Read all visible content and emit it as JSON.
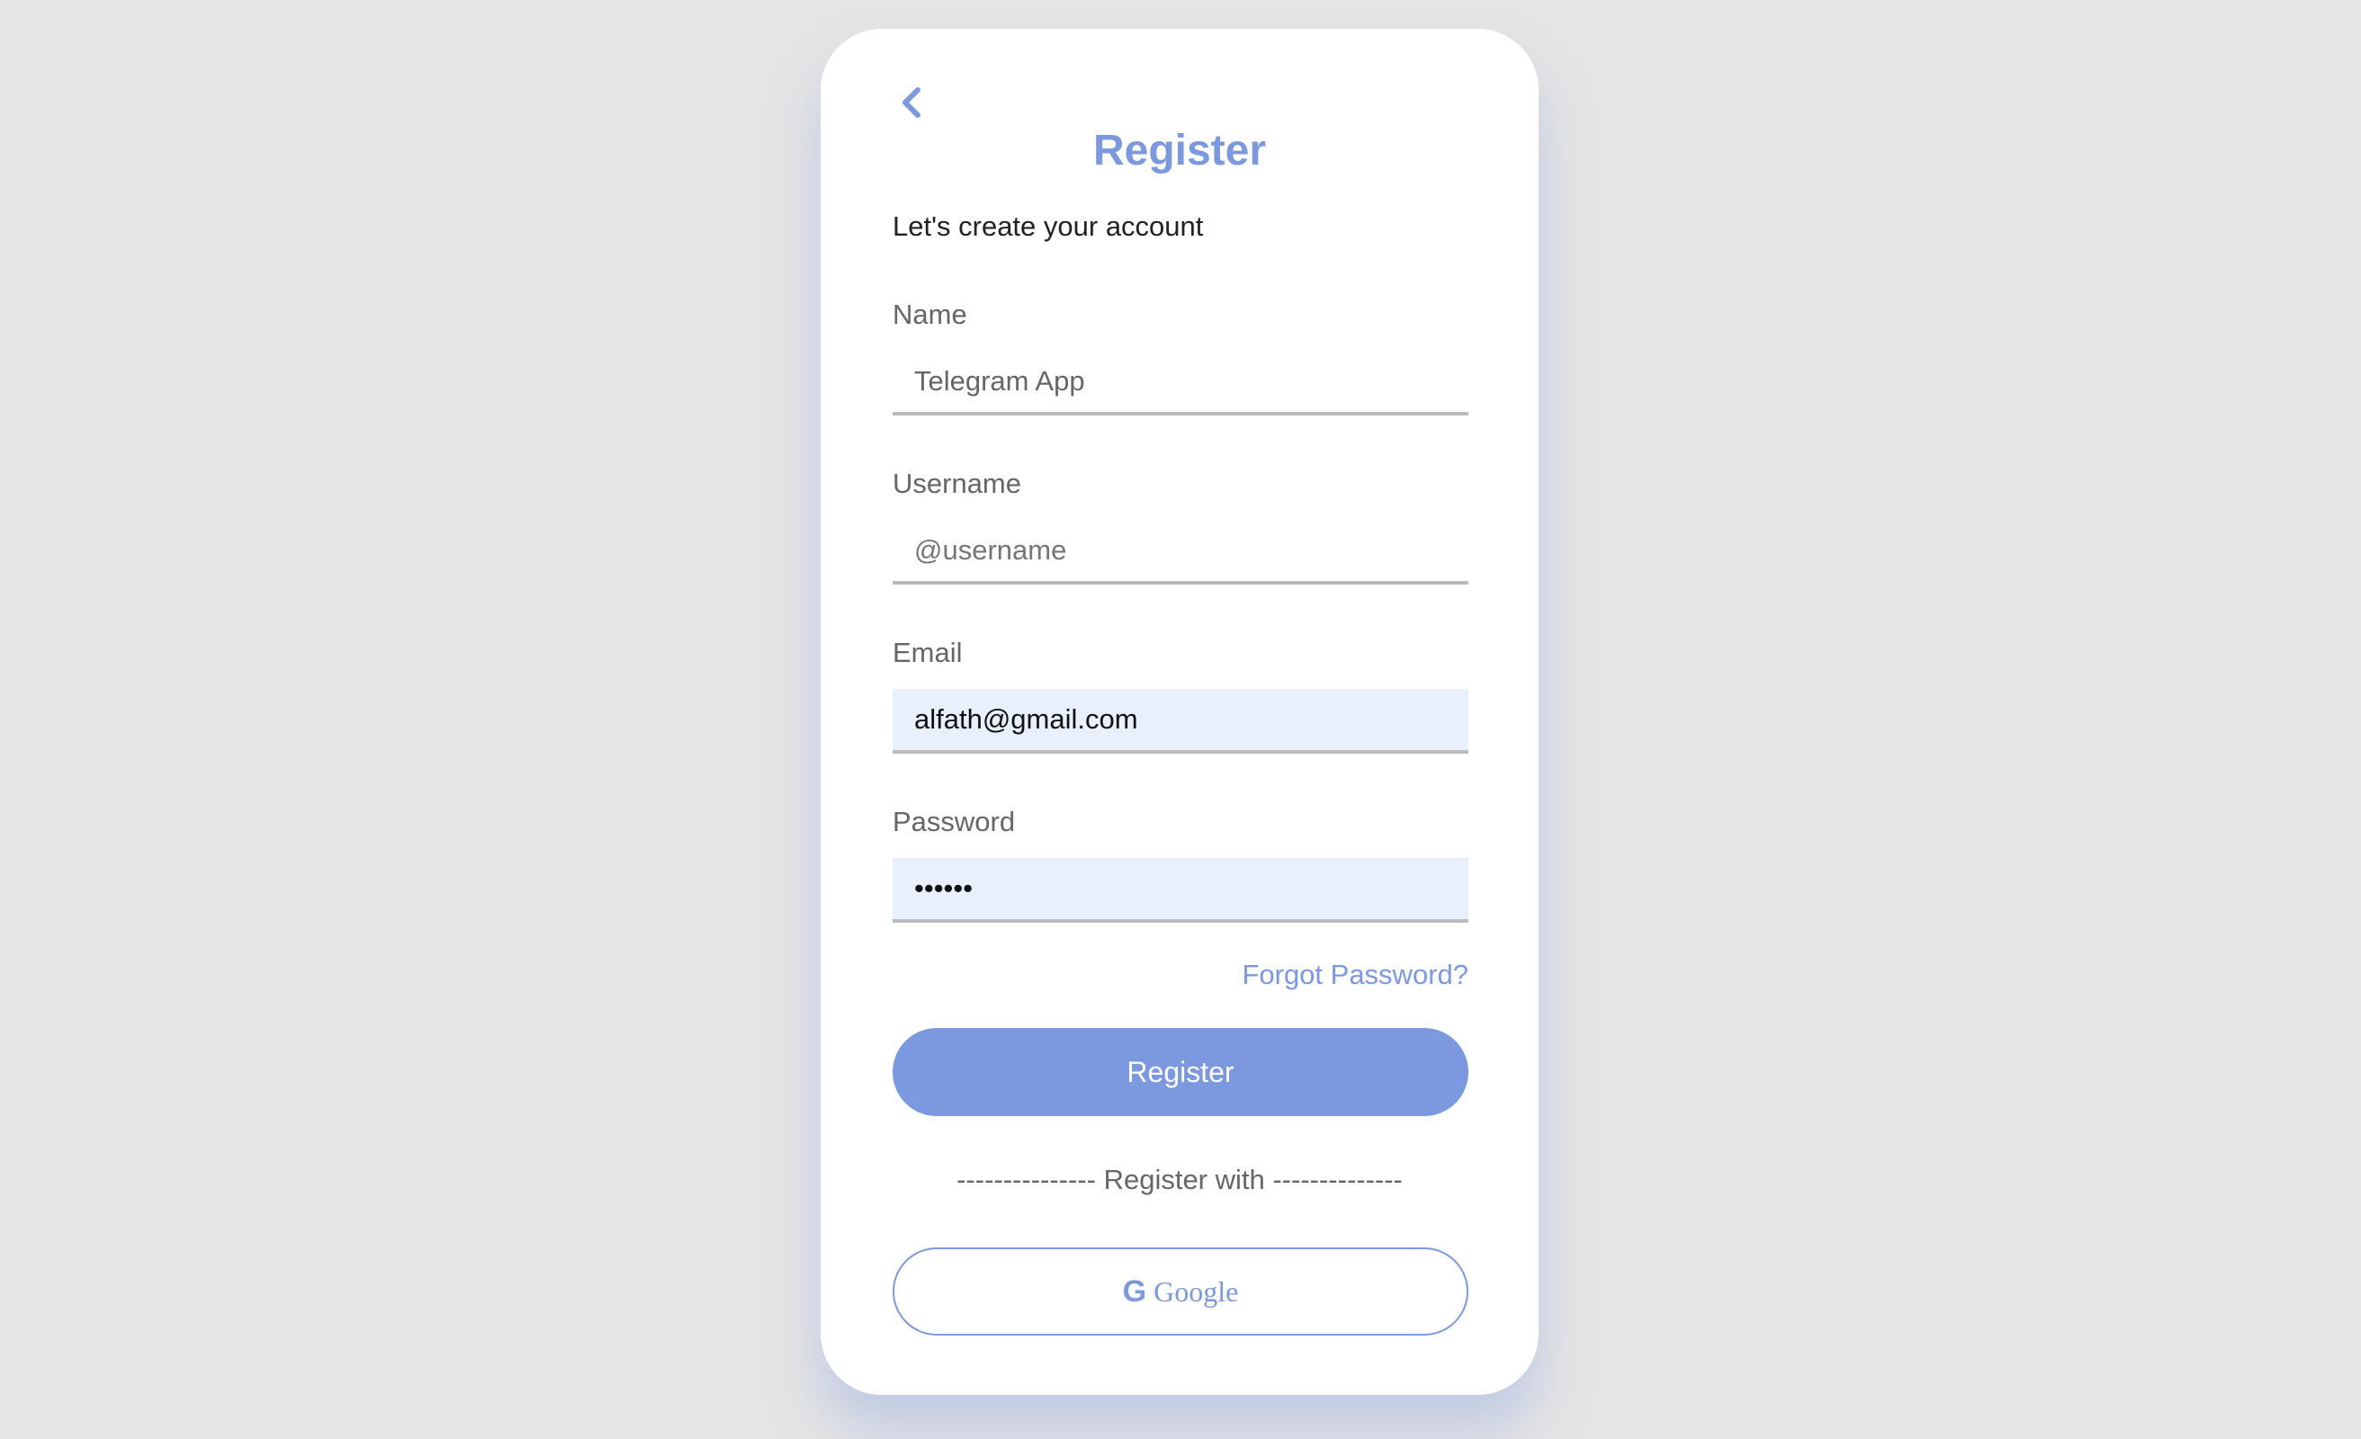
{
  "header": {
    "back_icon": "chevron-left-icon",
    "title": "Register",
    "subtitle": "Let's create your account"
  },
  "form": {
    "name": {
      "label": "Name",
      "value": "Telegram App"
    },
    "username": {
      "label": "Username",
      "placeholder": "@username"
    },
    "email": {
      "label": "Email",
      "value": "alfath@gmail.com"
    },
    "password": {
      "label": "Password",
      "value": "••••••"
    }
  },
  "forgot_password": "Forgot Password?",
  "register_button": "Register",
  "divider_text": "--------------- Register with --------------",
  "google_button": {
    "icon": "G",
    "label": "Google"
  },
  "colors": {
    "accent": "#7c98df",
    "autofill_bg": "#e8f0fe",
    "background": "#e5e5e5"
  }
}
